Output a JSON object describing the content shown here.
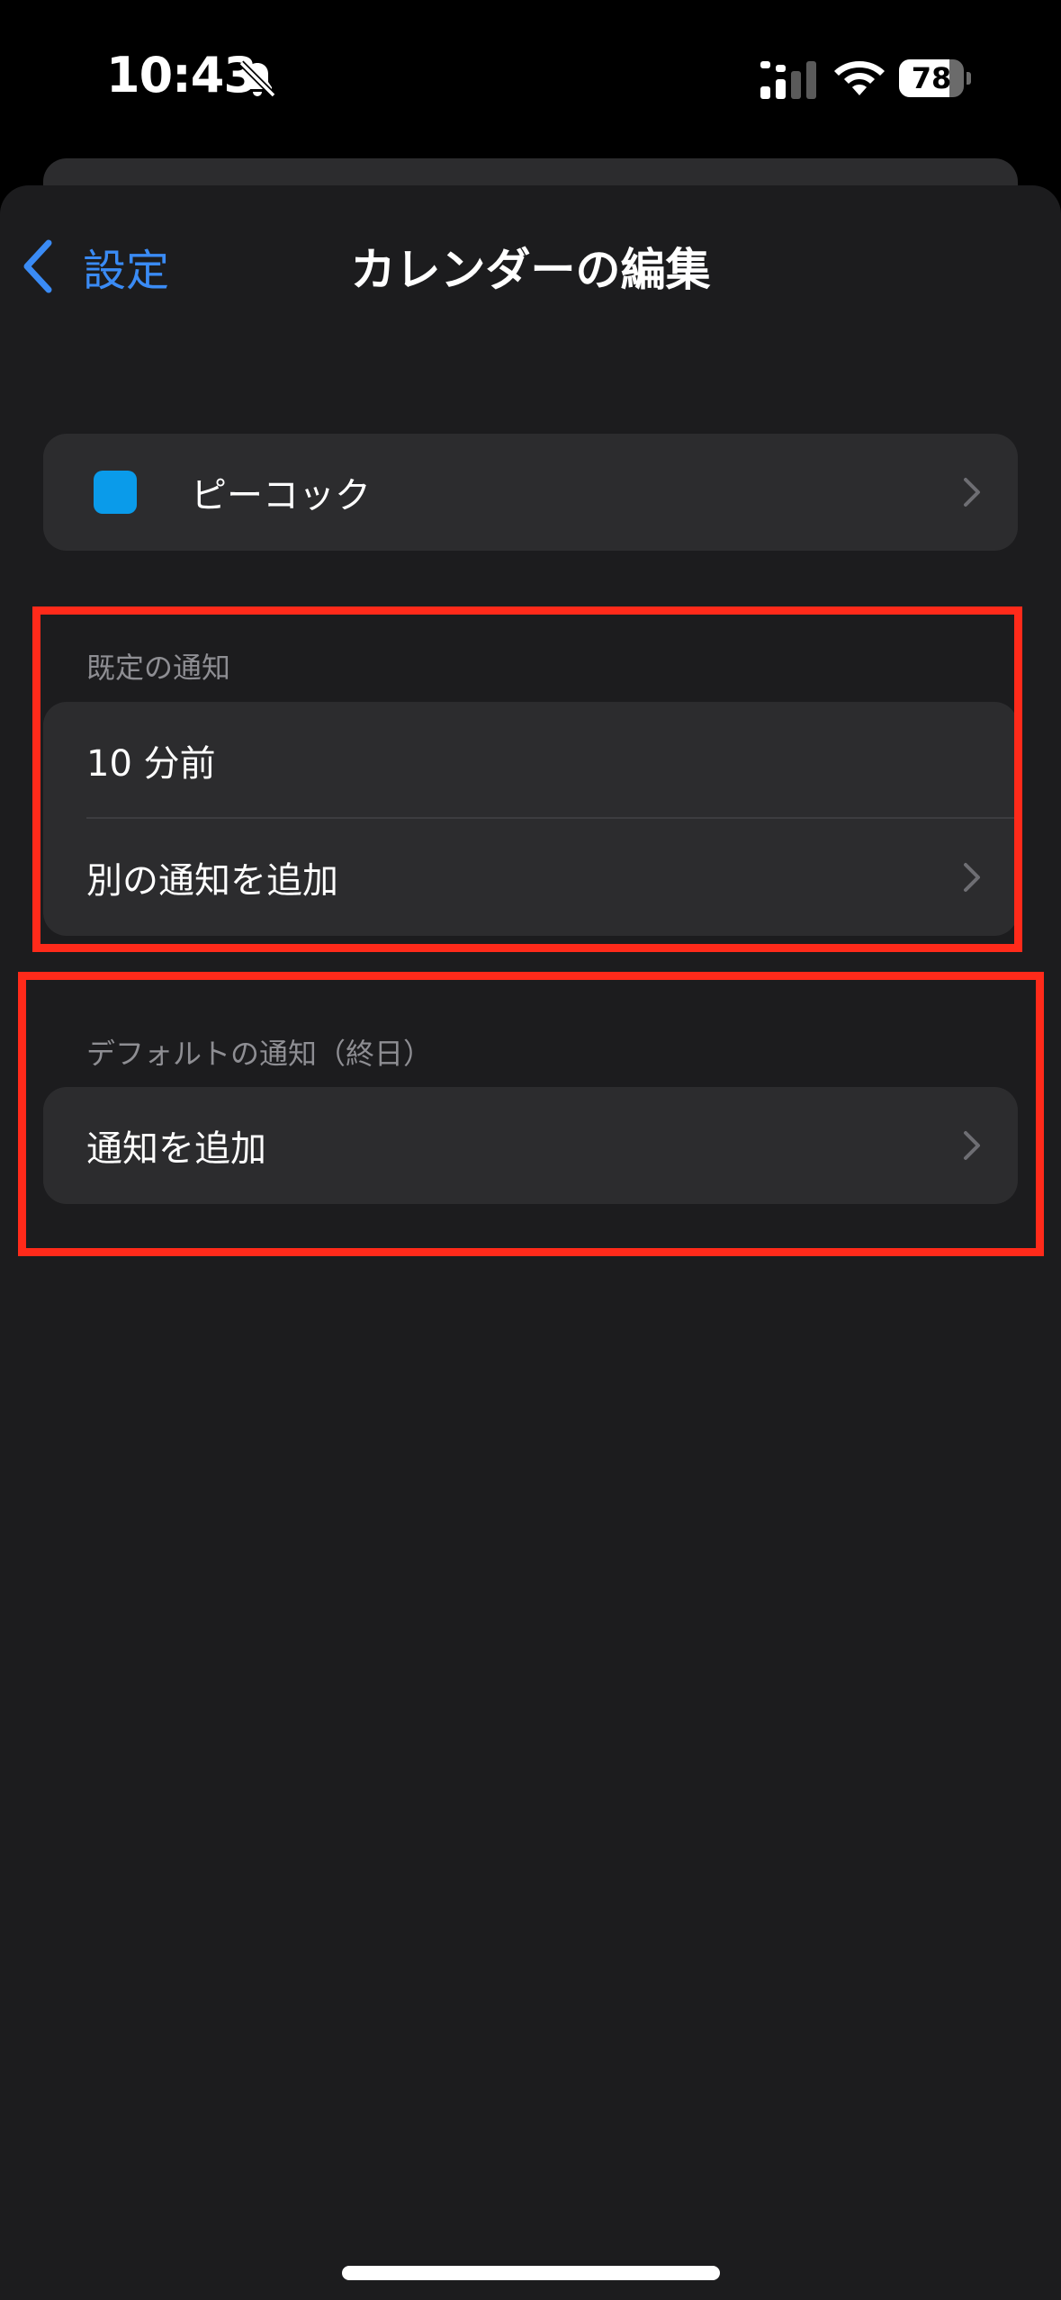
{
  "status_bar": {
    "time": "10:43",
    "battery_level": "78",
    "battery_fraction": 0.78
  },
  "nav": {
    "back_label": "設定",
    "title": "カレンダーの編集"
  },
  "calendar": {
    "name": "ピーコック",
    "color": "#0a9bea"
  },
  "default_alerts": {
    "header": "既定の通知",
    "items": [
      {
        "label": "10 分前"
      },
      {
        "label": "別の通知を追加"
      }
    ]
  },
  "all_day_alerts": {
    "header": "デフォルトの通知（終日）",
    "items": [
      {
        "label": "通知を追加"
      }
    ]
  },
  "colors": {
    "accent": "#3a8bf5",
    "highlight": "#ff2a1a",
    "background": "#1c1c1e",
    "cell": "#2c2c2e"
  }
}
